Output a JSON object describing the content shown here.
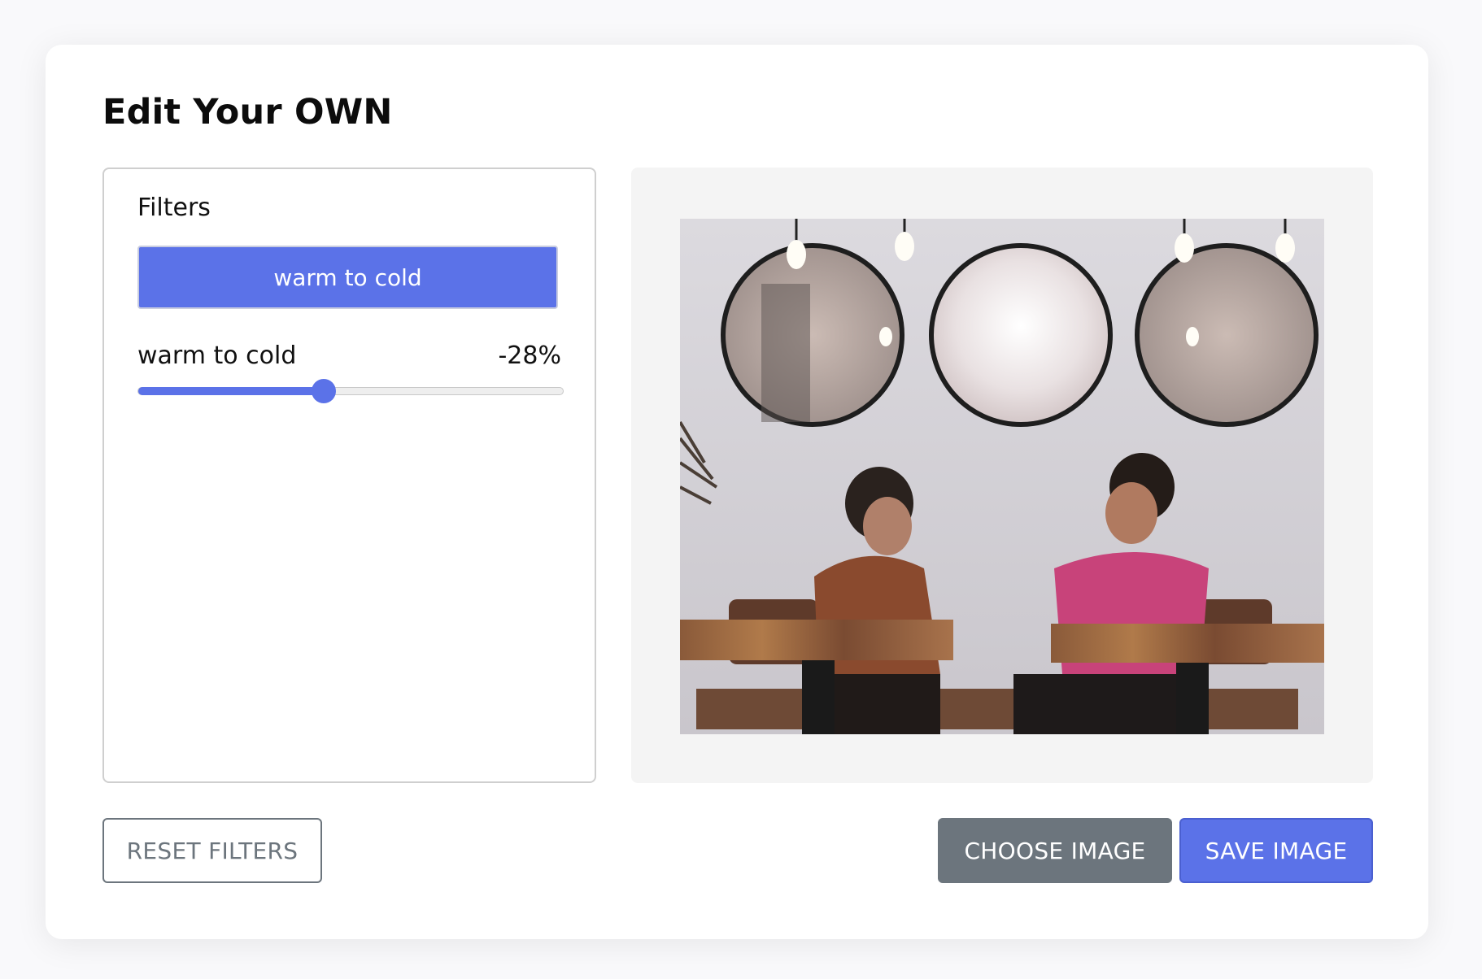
{
  "page": {
    "title": "Edit Your OWN"
  },
  "filters": {
    "heading": "Filters",
    "options": [
      {
        "label": "warm to cold",
        "active": true
      }
    ],
    "active_slider": {
      "label": "warm to cold",
      "value_text": "-28%",
      "fill_fraction": 0.435
    }
  },
  "buttons": {
    "reset": "RESET FILTERS",
    "choose": "CHOOSE IMAGE",
    "save": "SAVE IMAGE"
  },
  "colors": {
    "accent": "#5b72e8",
    "secondary": "#6c757d",
    "preview_bg": "#f4f4f4"
  }
}
